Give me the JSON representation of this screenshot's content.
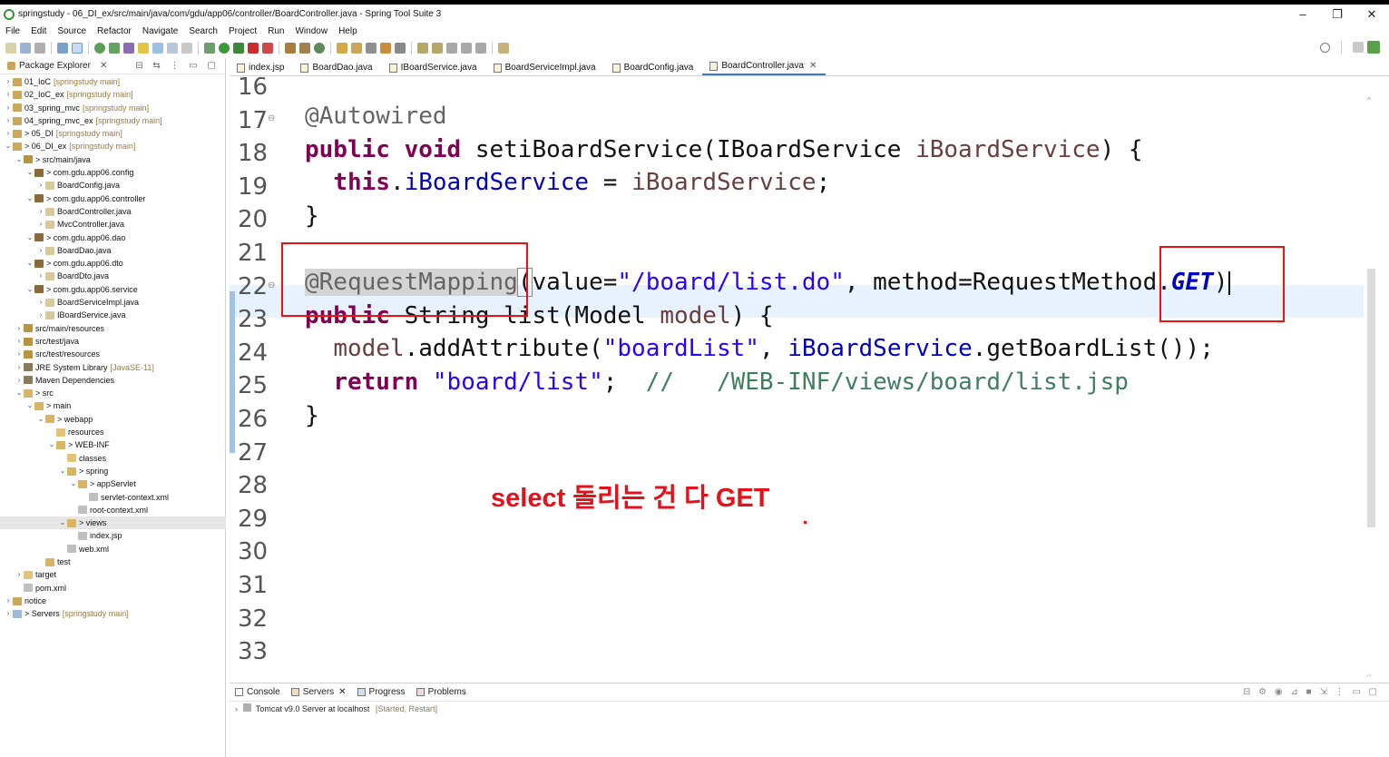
{
  "window": {
    "title": "springstudy - 06_DI_ex/src/main/java/com/gdu/app06/controller/BoardController.java - Spring Tool Suite 3",
    "controls": [
      "–",
      "❐",
      "✕"
    ]
  },
  "menu": [
    "File",
    "Edit",
    "Source",
    "Refactor",
    "Navigate",
    "Search",
    "Project",
    "Run",
    "Window",
    "Help"
  ],
  "package_explorer": {
    "title": "Package Explorer",
    "tree": [
      {
        "label": "01_IoC",
        "decor": "[springstudy main]"
      },
      {
        "label": "02_IoC_ex",
        "decor": "[springstudy main]"
      },
      {
        "label": "03_spring_mvc",
        "decor": "[springstudy main]"
      },
      {
        "label": "04_spring_mvc_ex",
        "decor": "[springstudy main]"
      },
      {
        "label": "> 05_DI",
        "decor": "[springstudy main]"
      },
      {
        "label": "> 06_DI_ex",
        "decor": "[springstudy main]"
      },
      {
        "label": "> src/main/java",
        "decor": ""
      },
      {
        "label": "> com.gdu.app06.config",
        "decor": ""
      },
      {
        "label": "BoardConfig.java",
        "decor": ""
      },
      {
        "label": "> com.gdu.app06.controller",
        "decor": ""
      },
      {
        "label": "BoardController.java",
        "decor": ""
      },
      {
        "label": "MvcController.java",
        "decor": ""
      },
      {
        "label": "> com.gdu.app06.dao",
        "decor": ""
      },
      {
        "label": "BoardDao.java",
        "decor": ""
      },
      {
        "label": "> com.gdu.app06.dto",
        "decor": ""
      },
      {
        "label": "BoardDto.java",
        "decor": ""
      },
      {
        "label": "> com.gdu.app06.service",
        "decor": ""
      },
      {
        "label": "BoardServiceImpl.java",
        "decor": ""
      },
      {
        "label": "IBoardService.java",
        "decor": ""
      },
      {
        "label": "src/main/resources",
        "decor": ""
      },
      {
        "label": "src/test/java",
        "decor": ""
      },
      {
        "label": "src/test/resources",
        "decor": ""
      },
      {
        "label": "JRE System Library",
        "decor": "[JavaSE-11]"
      },
      {
        "label": "Maven Dependencies",
        "decor": ""
      },
      {
        "label": "> src",
        "decor": ""
      },
      {
        "label": "> main",
        "decor": ""
      },
      {
        "label": "> webapp",
        "decor": ""
      },
      {
        "label": "resources",
        "decor": ""
      },
      {
        "label": "> WEB-INF",
        "decor": ""
      },
      {
        "label": "classes",
        "decor": ""
      },
      {
        "label": "> spring",
        "decor": ""
      },
      {
        "label": "> appServlet",
        "decor": ""
      },
      {
        "label": "servlet-context.xml",
        "decor": ""
      },
      {
        "label": "root-context.xml",
        "decor": ""
      },
      {
        "label": "> views",
        "decor": ""
      },
      {
        "label": "index.jsp",
        "decor": ""
      },
      {
        "label": "web.xml",
        "decor": ""
      },
      {
        "label": "test",
        "decor": ""
      },
      {
        "label": "target",
        "decor": ""
      },
      {
        "label": "pom.xml",
        "decor": ""
      },
      {
        "label": "notice",
        "decor": ""
      },
      {
        "label": "> Servers",
        "decor": "[springstudy main]"
      }
    ]
  },
  "editor": {
    "tabs": [
      "index.jsp",
      "BoardDao.java",
      "IBoardService.java",
      "BoardServiceImpl.java",
      "BoardConfig.java",
      "BoardController.java"
    ],
    "active_tab": "BoardController.java",
    "line_numbers": [
      "16",
      "17",
      "18",
      "19",
      "20",
      "21",
      "22",
      "23",
      "24",
      "25",
      "26",
      "27",
      "28",
      "29",
      "30",
      "31",
      "32",
      "33"
    ],
    "code": {
      "l17": "@Autowired",
      "l18_kw": "public void",
      "l18_rest": " setiBoardService(IBoardService ",
      "l18_param": "iBoardService",
      "l18_end": ") {",
      "l19_kw": "this",
      "l19_dot": ".",
      "l19_field": "iBoardService",
      "l19_eq": " = ",
      "l19_param": "iBoardService",
      "l19_end": ";",
      "l20": "}",
      "l22_ann": "@RequestMapping",
      "l22_open": "(",
      "l22_mid": "value=",
      "l22_str": "\"/board/list.do\"",
      "l22_mid2": ", method=RequestMethod.",
      "l22_const": "GET",
      "l22_close": ")",
      "l23_kw": "public",
      "l23_rest": " String list(Model ",
      "l23_param": "model",
      "l23_end": ") {",
      "l24_param": "model",
      "l24_mid": ".addAttribute(",
      "l24_str": "\"boardList\"",
      "l24_mid2": ", ",
      "l24_field": "iBoardService",
      "l24_end": ".getBoardList());",
      "l25_kw": "return",
      "l25_str": "\"board/list\"",
      "l25_semi": ";",
      "l25_cmt": "//   /WEB-INF/views/board/list.jsp",
      "l26": "}"
    }
  },
  "annotation": {
    "text": "select 돌리는 건 다 GET",
    "color": "#e5101a"
  },
  "console": {
    "tabs": [
      "Console",
      "Servers",
      "Progress",
      "Problems"
    ],
    "server": "Tomcat v9.0 Server at localhost",
    "status": "[Started, Restart]"
  },
  "colors": {
    "keyword": "#7f0055",
    "string": "#2a00ff",
    "field": "#0000c0",
    "comment": "#3f7f5f",
    "highlight_box": "#ee1111"
  }
}
